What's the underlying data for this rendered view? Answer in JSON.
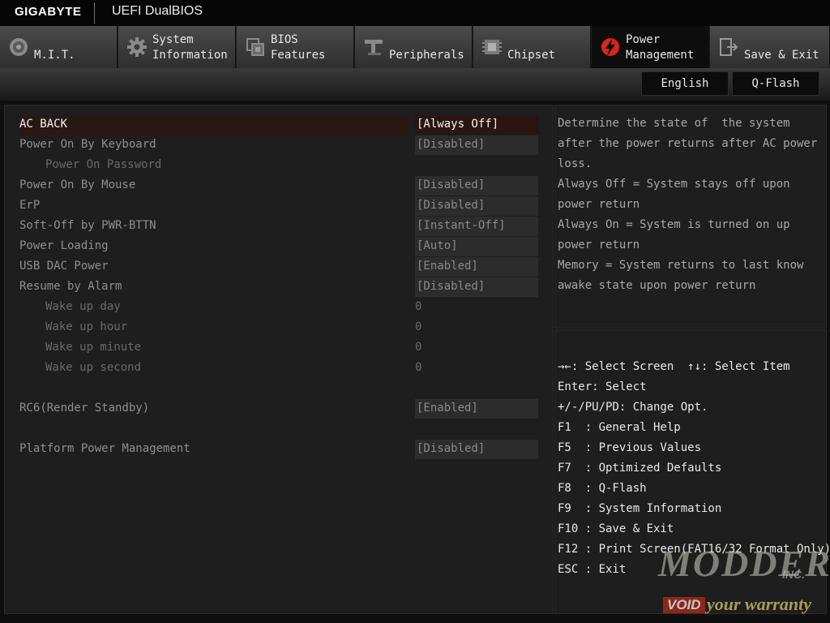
{
  "header": {
    "brand": "GIGABYTE",
    "product": "UEFI DualBIOS"
  },
  "tabs": [
    {
      "label": "M.I.T.",
      "icon": "gauge-icon"
    },
    {
      "label": "System\nInformation",
      "icon": "gear-icon"
    },
    {
      "label": "BIOS\nFeatures",
      "icon": "chip-icon"
    },
    {
      "label": "Peripherals",
      "icon": "connector-icon"
    },
    {
      "label": "Chipset",
      "icon": "chipset-icon"
    },
    {
      "label": "Power\nManagement",
      "icon": "power-bolt-icon",
      "active": true
    },
    {
      "label": "Save & Exit",
      "icon": "exit-icon"
    }
  ],
  "buttons": {
    "language": "English",
    "qflash": "Q-Flash"
  },
  "settings": [
    {
      "label": "AC BACK",
      "value": "[Always Off]"
    },
    {
      "label": "Power On By Keyboard",
      "value": "[Disabled]"
    },
    {
      "label": "Power On Password",
      "value": ""
    },
    {
      "label": "Power On By Mouse",
      "value": "[Disabled]"
    },
    {
      "label": "ErP",
      "value": "[Disabled]"
    },
    {
      "label": "Soft-Off by PWR-BTTN",
      "value": "[Instant-Off]"
    },
    {
      "label": "Power Loading",
      "value": "[Auto]"
    },
    {
      "label": "USB DAC Power",
      "value": "[Enabled]"
    },
    {
      "label": "Resume by Alarm",
      "value": "[Disabled]"
    },
    {
      "label": "Wake up day",
      "value": "0"
    },
    {
      "label": "Wake up hour",
      "value": "0"
    },
    {
      "label": "Wake up minute",
      "value": "0"
    },
    {
      "label": "Wake up second",
      "value": "0"
    },
    {
      "label": "RC6(Render Standby)",
      "value": "[Enabled]"
    },
    {
      "label": "Platform Power Management",
      "value": "[Disabled]"
    }
  ],
  "help_lines": [
    "Determine the state of  the system",
    "after the power returns after AC power",
    "loss.",
    "Always Off = System stays off upon",
    "power return",
    "Always On = System is turned on up",
    "power return",
    "Memory = System returns to last know",
    "awake state upon power return"
  ],
  "key_lines": [
    "→←: Select Screen  ↑↓: Select Item",
    "Enter: Select",
    "+/-/PU/PD: Change Opt.",
    "F1  : General Help",
    "F5  : Previous Values",
    "F7  : Optimized Defaults",
    "F8  : Q-Flash",
    "F9  : System Information",
    "F10 : Save & Exit",
    "F12 : Print Screen(FAT16/32 Format Only)",
    "ESC : Exit"
  ],
  "watermark": {
    "line1": "MODDERS",
    "line2": "INC.",
    "line3": "VOID",
    "line4": "your warranty"
  }
}
